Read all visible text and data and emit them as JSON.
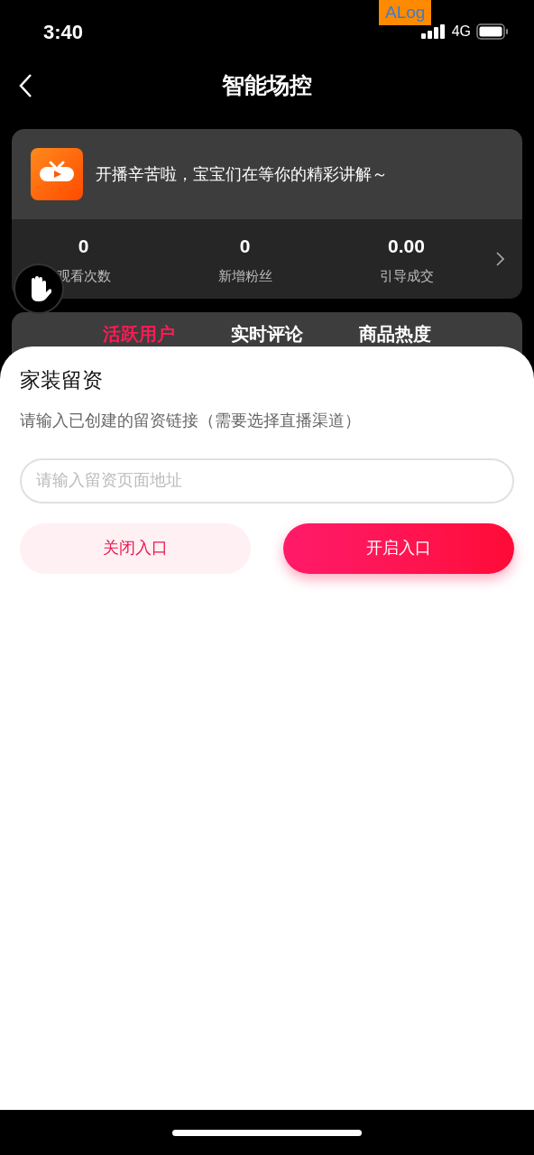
{
  "status_bar": {
    "time": "3:40",
    "network": "4G",
    "debug_badge": "ALog"
  },
  "header": {
    "title": "智能场控"
  },
  "banner": {
    "message": "开播辛苦啦，宝宝们在等你的精彩讲解～"
  },
  "stats": [
    {
      "value": "0",
      "label": "观看次数"
    },
    {
      "value": "0",
      "label": "新增粉丝"
    },
    {
      "value": "0.00",
      "label": "引导成交"
    }
  ],
  "tabs": [
    {
      "label": "活跃用户",
      "selected": true
    },
    {
      "label": "实时评论",
      "selected": false
    },
    {
      "label": "商品热度",
      "selected": false
    }
  ],
  "sheet": {
    "title": "家装留资",
    "description": "请输入已创建的留资链接（需要选择直播渠道）",
    "input": {
      "placeholder": "请输入留资页面地址"
    },
    "buttons": [
      {
        "label": "关闭入口",
        "kind": "secondary"
      },
      {
        "label": "开启入口",
        "kind": "primary"
      }
    ]
  }
}
